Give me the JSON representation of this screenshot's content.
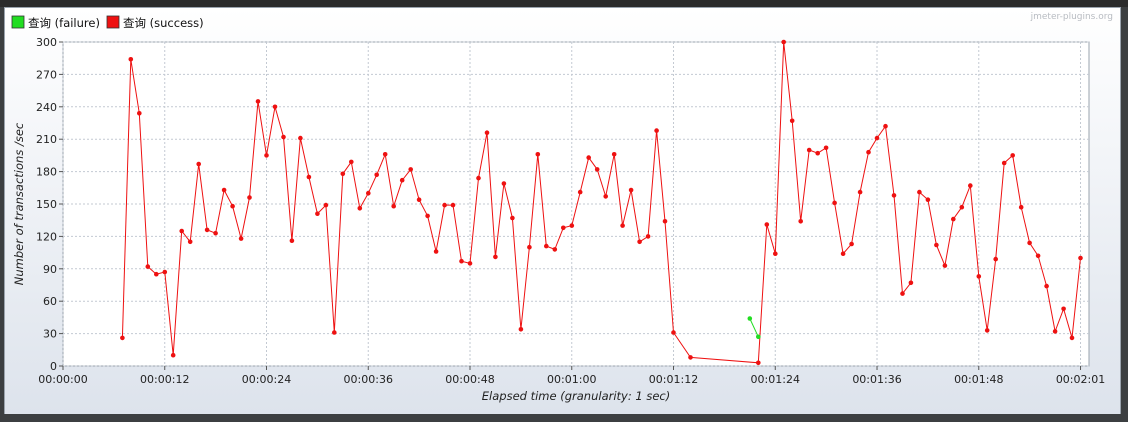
{
  "colors": {
    "failure": "#00dd00",
    "success": "#ee0000",
    "grid": "#c3c9d2",
    "plot_bg": "#ffffff"
  },
  "legend": [
    {
      "label": "查询 (failure)",
      "color": "#22dd22"
    },
    {
      "label": "查询 (success)",
      "color": "#ee1111"
    }
  ],
  "watermark": "jmeter-plugins.org",
  "chart_data": {
    "type": "line",
    "title": "",
    "xlabel": "Elapsed time (granularity: 1 sec)",
    "ylabel": "Number of transactions /sec",
    "xlim": [
      0,
      121
    ],
    "ylim": [
      0,
      300
    ],
    "x_ticks": [
      {
        "v": 0,
        "label": "00:00:00"
      },
      {
        "v": 12,
        "label": "00:00:12"
      },
      {
        "v": 24,
        "label": "00:00:24"
      },
      {
        "v": 36,
        "label": "00:00:36"
      },
      {
        "v": 48,
        "label": "00:00:48"
      },
      {
        "v": 60,
        "label": "00:01:00"
      },
      {
        "v": 72,
        "label": "00:01:12"
      },
      {
        "v": 84,
        "label": "00:01:24"
      },
      {
        "v": 96,
        "label": "00:01:36"
      },
      {
        "v": 108,
        "label": "00:01:48"
      },
      {
        "v": 120,
        "label": "00:02:01"
      }
    ],
    "y_ticks": [
      0,
      30,
      60,
      90,
      120,
      150,
      180,
      210,
      240,
      270,
      300
    ],
    "grid": true,
    "legend_position": "top-left",
    "series": [
      {
        "name": "查询 (failure)",
        "color": "#22dd22",
        "x": [
          81,
          82
        ],
        "y": [
          44,
          27
        ]
      },
      {
        "name": "查询 (success)",
        "color": "#ee1111",
        "x": [
          7,
          8,
          9,
          10,
          11,
          12,
          13,
          14,
          15,
          16,
          17,
          18,
          19,
          20,
          21,
          22,
          23,
          24,
          25,
          26,
          27,
          28,
          29,
          30,
          31,
          32,
          33,
          34,
          35,
          36,
          37,
          38,
          39,
          40,
          41,
          42,
          43,
          44,
          45,
          46,
          47,
          48,
          49,
          50,
          51,
          52,
          53,
          54,
          55,
          56,
          57,
          58,
          59,
          60,
          61,
          62,
          63,
          64,
          65,
          66,
          67,
          68,
          69,
          70,
          71,
          72,
          74,
          82,
          83,
          84,
          85,
          86,
          87,
          88,
          89,
          90,
          91,
          92,
          93,
          94,
          95,
          96,
          97,
          98,
          99,
          100,
          101,
          102,
          103,
          104,
          105,
          106,
          107,
          108,
          109,
          110,
          111,
          112,
          113,
          114,
          115,
          116,
          117,
          118,
          119,
          120
        ],
        "y": [
          26,
          284,
          234,
          92,
          85,
          87,
          10,
          125,
          115,
          187,
          126,
          123,
          163,
          148,
          118,
          156,
          245,
          195,
          240,
          212,
          116,
          211,
          175,
          141,
          149,
          31,
          178,
          189,
          146,
          160,
          177,
          196,
          148,
          172,
          182,
          154,
          139,
          106,
          149,
          149,
          97,
          95,
          174,
          216,
          101,
          169,
          137,
          34,
          110,
          196,
          111,
          108,
          128,
          130,
          161,
          193,
          182,
          157,
          196,
          130,
          163,
          115,
          120,
          218,
          134,
          31,
          8,
          3,
          131,
          104,
          300,
          227,
          134,
          200,
          197,
          202,
          151,
          104,
          113,
          161,
          198,
          211,
          222,
          158,
          67,
          77,
          161,
          154,
          112,
          93,
          136,
          147,
          167,
          83,
          33,
          99,
          188,
          195,
          147,
          114,
          102,
          74,
          32,
          53,
          26,
          100
        ]
      }
    ]
  }
}
